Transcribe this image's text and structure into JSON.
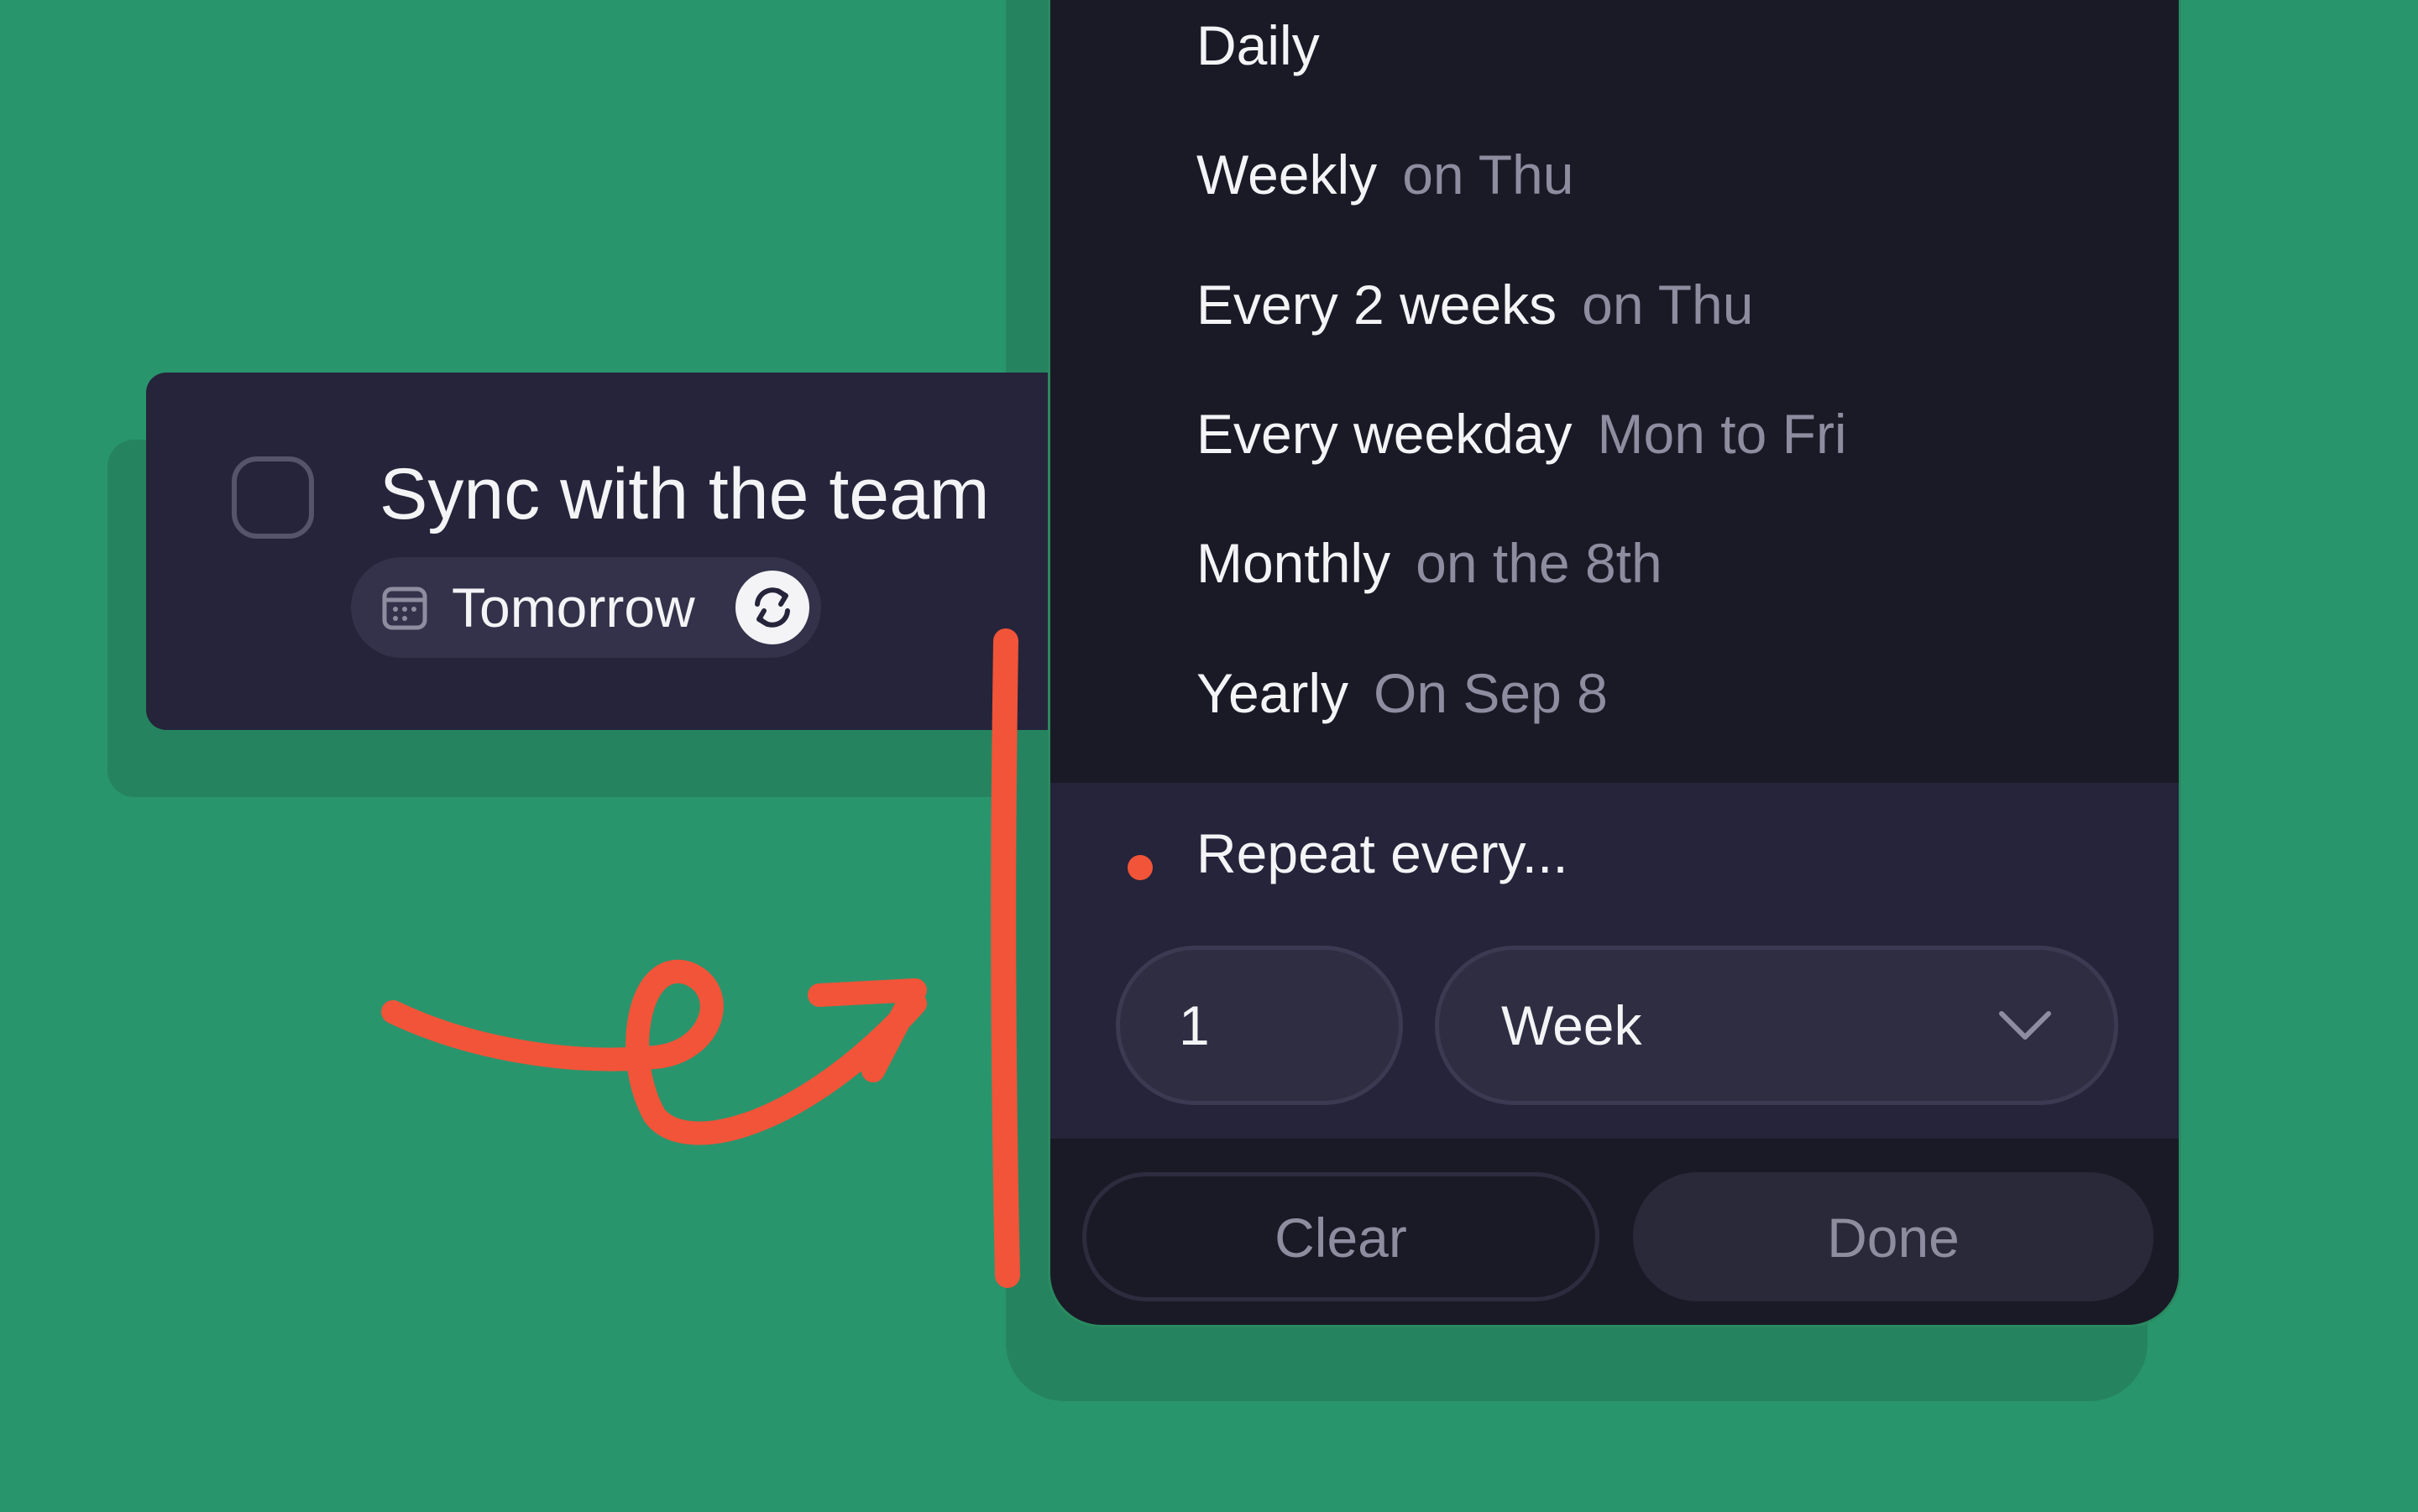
{
  "colors": {
    "background": "#29956d",
    "accent": "#f15438",
    "card": "#25243a",
    "popover": "#1a1a27"
  },
  "task": {
    "title": "Sync with the team",
    "date_label": "Tomorrow",
    "calendar_icon": "calendar-icon",
    "repeat_icon": "repeat-icon"
  },
  "repeat_menu": {
    "options": [
      {
        "label": "Daily",
        "detail": ""
      },
      {
        "label": "Weekly",
        "detail": "on Thu"
      },
      {
        "label": "Every 2 weeks",
        "detail": "on Thu"
      },
      {
        "label": "Every weekday",
        "detail": "Mon to Fri"
      },
      {
        "label": "Monthly",
        "detail": "on the 8th"
      },
      {
        "label": "Yearly",
        "detail": "On Sep 8"
      }
    ],
    "custom": {
      "label": "Repeat every...",
      "interval_value": "1",
      "unit_value": "Week",
      "chevron_icon": "chevron-down-icon"
    },
    "buttons": {
      "clear": "Clear",
      "done": "Done"
    }
  }
}
